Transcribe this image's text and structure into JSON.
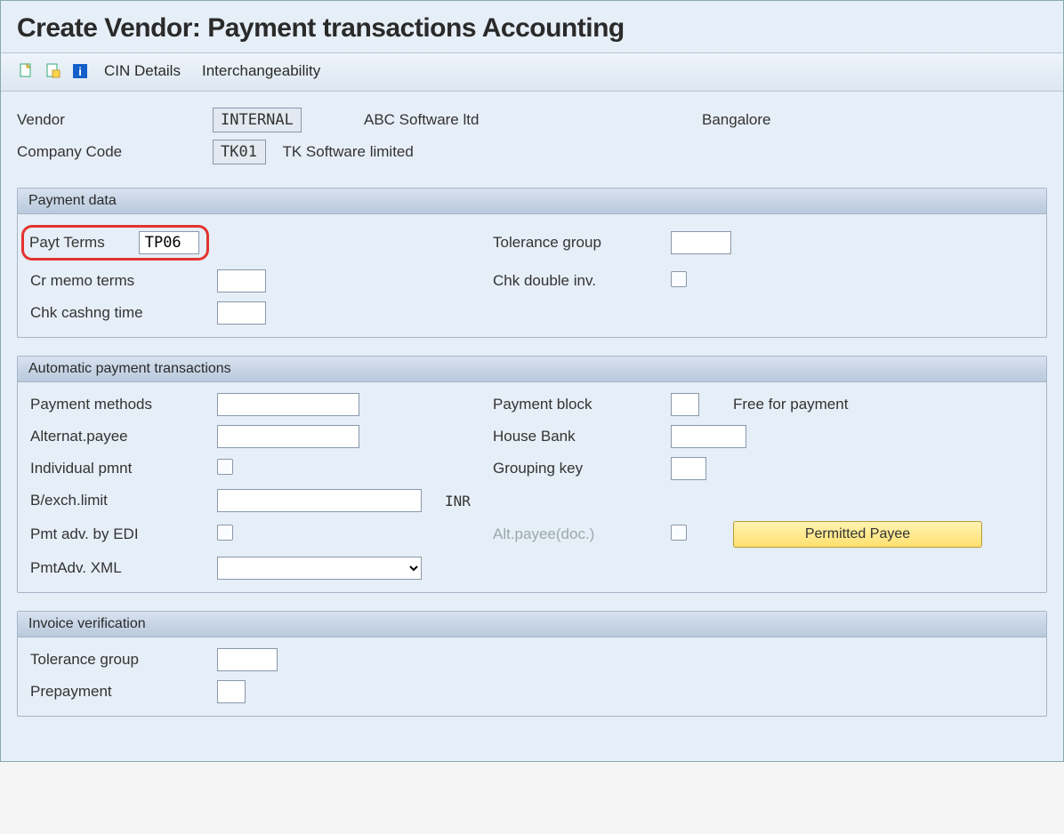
{
  "title": "Create Vendor: Payment transactions Accounting",
  "toolbar": {
    "cin_label": "CIN Details",
    "interch_label": "Interchangeability"
  },
  "header": {
    "vendor_label": "Vendor",
    "vendor_code": "INTERNAL",
    "vendor_name": "ABC Software ltd",
    "vendor_city": "Bangalore",
    "company_code_label": "Company Code",
    "company_code": "TK01",
    "company_name": "TK Software limited"
  },
  "payment_data": {
    "group_title": "Payment data",
    "payt_terms_label": "Payt Terms",
    "payt_terms_value": "TP06",
    "tolerance_group_label": "Tolerance group",
    "tolerance_group_value": "",
    "cr_memo_label": "Cr memo terms",
    "cr_memo_value": "",
    "chk_double_label": "Chk double inv.",
    "chk_cashng_label": "Chk cashng time",
    "chk_cashng_value": ""
  },
  "auto_payment": {
    "group_title": "Automatic payment transactions",
    "payment_methods_label": "Payment methods",
    "payment_methods_value": "",
    "payment_block_label": "Payment block",
    "payment_block_value": "",
    "payment_block_text": "Free for payment",
    "alternat_payee_label": "Alternat.payee",
    "alternat_payee_value": "",
    "house_bank_label": "House Bank",
    "house_bank_value": "",
    "individual_pmnt_label": "Individual pmnt",
    "grouping_key_label": "Grouping key",
    "grouping_key_value": "",
    "bexch_limit_label": "B/exch.limit",
    "bexch_limit_value": "",
    "bexch_currency": "INR",
    "pmt_adv_edi_label": "Pmt adv. by EDI",
    "alt_payee_doc_label": "Alt.payee(doc.)",
    "permitted_payee_label": "Permitted Payee",
    "pmtadv_xml_label": "PmtAdv. XML",
    "pmtadv_xml_value": ""
  },
  "invoice_verification": {
    "group_title": "Invoice verification",
    "tolerance_group_label": "Tolerance group",
    "tolerance_group_value": "",
    "prepayment_label": "Prepayment",
    "prepayment_value": ""
  }
}
